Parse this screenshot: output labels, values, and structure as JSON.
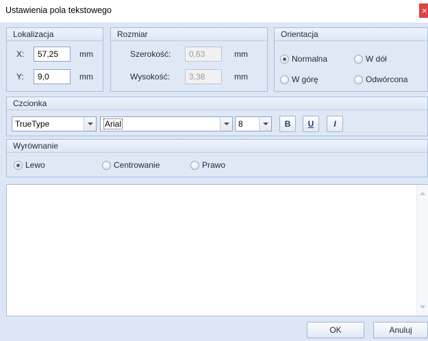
{
  "window": {
    "title": "Ustawienia pola tekstowego",
    "close_glyph": "×"
  },
  "lokalizacja": {
    "title": "Lokalizacja",
    "x_label": "X:",
    "x_value": "57,25",
    "x_unit": "mm",
    "y_label": "Y:",
    "y_value": "9,0",
    "y_unit": "mm"
  },
  "rozmiar": {
    "title": "Rozmiar",
    "width_label": "Szerokość:",
    "width_value": "0,63",
    "width_unit": "mm",
    "height_label": "Wysokość:",
    "height_value": "3,38",
    "height_unit": "mm"
  },
  "orientacja": {
    "title": "Orientacja",
    "options": [
      {
        "label": "Normalna",
        "checked": true
      },
      {
        "label": "W dół",
        "checked": false
      },
      {
        "label": "W górę",
        "checked": false
      },
      {
        "label": "Odwórcona",
        "checked": false
      }
    ]
  },
  "czcionka": {
    "title": "Czcionka",
    "type_value": "TrueType",
    "font_value": "Arial",
    "size_value": "8",
    "bold_label": "B",
    "underline_label": "U",
    "italic_label": "I"
  },
  "wyrownanie": {
    "title": "Wyrównanie",
    "options": [
      {
        "label": "Lewo",
        "checked": true
      },
      {
        "label": "Centrowanie",
        "checked": false
      },
      {
        "label": "Prawo",
        "checked": false
      }
    ]
  },
  "text_content": "",
  "buttons": {
    "ok": "OK",
    "cancel": "Anuluj"
  },
  "icons": {
    "close": "close-icon",
    "scroll_up": "scroll-up-icon",
    "scroll_down": "scroll-down-icon",
    "dropdown": "chevron-down-icon"
  }
}
